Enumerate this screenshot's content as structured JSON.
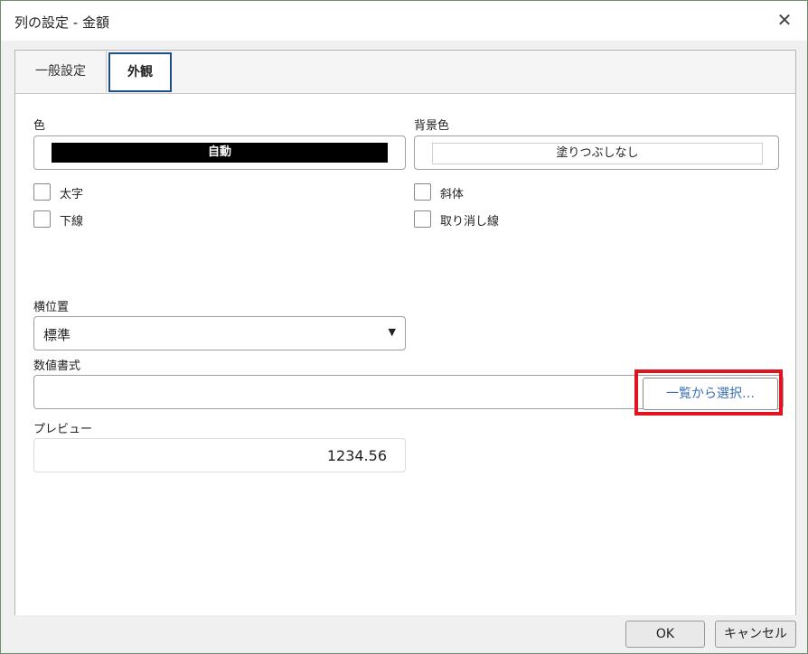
{
  "window": {
    "title": "列の設定 - 金額",
    "close_glyph": "✕"
  },
  "tabs": [
    {
      "label": "一般設定",
      "active": false
    },
    {
      "label": "外観",
      "active": true
    }
  ],
  "appearance": {
    "color_label": "色",
    "color_value": "自動",
    "background_label": "背景色",
    "background_value": "塗りつぶしなし",
    "checkboxes": [
      {
        "label": "太字",
        "checked": false
      },
      {
        "label": "下線",
        "checked": false
      },
      {
        "label": "斜体",
        "checked": false
      },
      {
        "label": "取り消し線",
        "checked": false
      }
    ],
    "horizontal_position_label": "横位置",
    "horizontal_position_value": "標準",
    "number_format_label": "数値書式",
    "number_format_value": "",
    "select_from_list_button": "一覧から選択…",
    "preview_label": "プレビュー",
    "preview_value": "1234.56"
  },
  "footer": {
    "ok_label": "OK",
    "cancel_label": "キャンセル"
  },
  "colors": {
    "highlight": "#e0141e",
    "tab_border": "#1f4e8c",
    "link_text": "#3a6eb5"
  }
}
